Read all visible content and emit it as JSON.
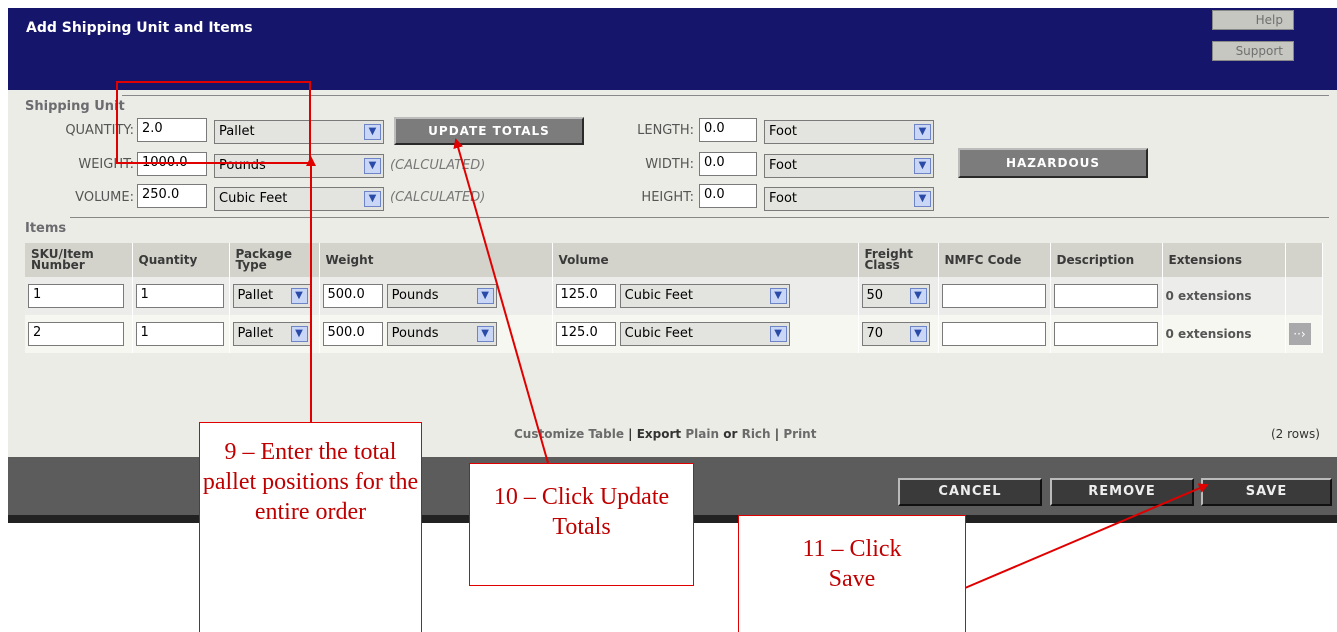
{
  "title": "Add Shipping Unit and Items",
  "top_buttons": {
    "help": "Help",
    "support": "Support"
  },
  "shipping_unit": {
    "heading": "Shipping Unit",
    "quantity_label": "QUANTITY:",
    "quantity_value": "2.0",
    "quantity_unit": "Pallet",
    "weight_label": "WEIGHT:",
    "weight_value": "1000.0",
    "weight_unit": "Pounds",
    "volume_label": "VOLUME:",
    "volume_value": "250.0",
    "volume_unit": "Cubic Feet",
    "calculated": "(CALCULATED)",
    "update_totals": "UPDATE TOTALS",
    "length_label": "LENGTH:",
    "length_value": "0.0",
    "length_unit": "Foot",
    "width_label": "WIDTH:",
    "width_value": "0.0",
    "width_unit": "Foot",
    "height_label": "HEIGHT:",
    "height_value": "0.0",
    "height_unit": "Foot",
    "hazardous": "HAZARDOUS"
  },
  "items": {
    "heading": "Items",
    "columns": [
      "SKU/Item Number",
      "Quantity",
      "Package Type",
      "Weight",
      "Volume",
      "Freight Class",
      "NMFC Code",
      "Description",
      "Extensions"
    ],
    "rows": [
      {
        "sku": "1",
        "quantity": "1",
        "package": "Pallet",
        "weight": "500.0",
        "weight_unit": "Pounds",
        "volume": "125.0",
        "volume_unit": "Cubic Feet",
        "freight_class": "50",
        "nmfc": "",
        "description": "",
        "extensions": "0 extensions"
      },
      {
        "sku": "2",
        "quantity": "1",
        "package": "Pallet",
        "weight": "500.0",
        "weight_unit": "Pounds",
        "volume": "125.0",
        "volume_unit": "Cubic Feet",
        "freight_class": "70",
        "nmfc": "",
        "description": "",
        "extensions": "0 extensions"
      }
    ],
    "footer": {
      "customize": "Customize Table",
      "sep1": "|",
      "export": "Export",
      "plain": "Plain",
      "or": "or",
      "rich": "Rich",
      "sep2": "|",
      "print": "Print",
      "row_count": "(2 rows)"
    }
  },
  "bottom_buttons": {
    "cancel": "CANCEL",
    "remove": "REMOVE",
    "save": "SAVE"
  },
  "callouts": {
    "step9": "9 – Enter the total pallet positions for the entire order",
    "step10": "10 – Click Update Totals",
    "step11": "11 – Click Save"
  },
  "colors": {
    "title_bar": "#15156b",
    "annotation": "#e00000"
  }
}
